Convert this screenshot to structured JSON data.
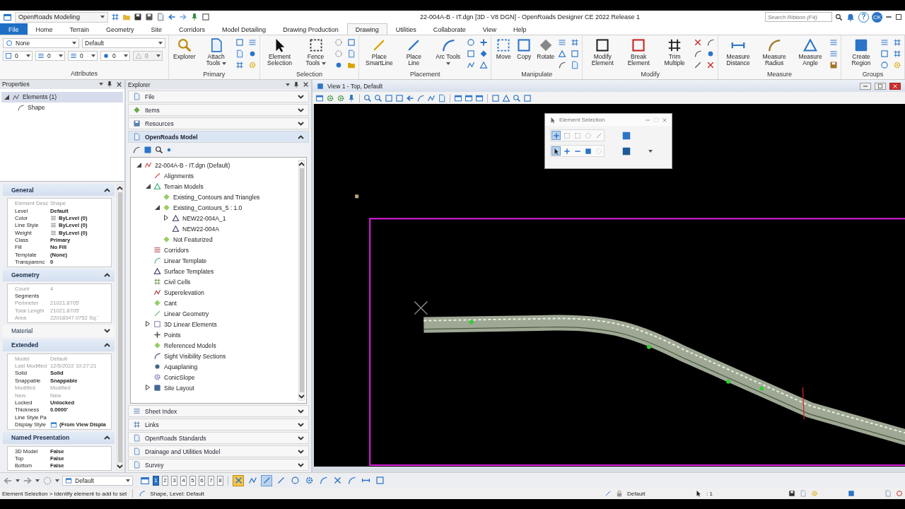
{
  "title_bar": {
    "workflow": "OpenRoads Modeling",
    "title": "22-004A-B - IT.dgn [3D - V8 DGN] - OpenRoads Designer CE 2022 Release 1",
    "search": {
      "placeholder": "Search Ribbon (F4)"
    },
    "help": "?",
    "user": "CK"
  },
  "ribbon_tabs": [
    {
      "label": "File",
      "kind": "backstage",
      "selected": false
    },
    {
      "label": "Home",
      "kind": "tab",
      "selected": false
    },
    {
      "label": "Terrain",
      "kind": "tab",
      "selected": false
    },
    {
      "label": "Geometry",
      "kind": "tab",
      "selected": false
    },
    {
      "label": "Site",
      "kind": "tab",
      "selected": false
    },
    {
      "label": "Corridors",
      "kind": "tab",
      "selected": false
    },
    {
      "label": "Model Detailing",
      "kind": "tab",
      "selected": false
    },
    {
      "label": "Drawing Production",
      "kind": "tab",
      "selected": false
    },
    {
      "label": "Drawing",
      "kind": "tab",
      "selected": true
    },
    {
      "label": "Utilities",
      "kind": "tab",
      "selected": false
    },
    {
      "label": "Collaborate",
      "kind": "tab",
      "selected": false
    },
    {
      "label": "View",
      "kind": "tab",
      "selected": false
    },
    {
      "label": "Help",
      "kind": "tab",
      "selected": false
    }
  ],
  "ribbon_groups": [
    {
      "label": "Attributes",
      "kind": "attributes",
      "dropdowns": [
        "None",
        "Default"
      ],
      "fields": [
        {
          "value": "0",
          "disabled": false
        },
        {
          "value": "0",
          "disabled": false
        },
        {
          "value": "0",
          "disabled": false
        },
        {
          "value": "0",
          "disabled": false
        },
        {
          "value": "0",
          "disabled": true
        }
      ]
    },
    {
      "label": "Primary",
      "kind": "tools",
      "buttons": [
        {
          "label": "Explorer",
          "dropdown": false
        },
        {
          "label": "Attach Tools",
          "dropdown": true
        }
      ]
    },
    {
      "label": "Selection",
      "kind": "tools",
      "buttons": [
        {
          "label": "Element Selection",
          "dropdown": false
        },
        {
          "label": "Fence Tools",
          "dropdown": true
        }
      ]
    },
    {
      "label": "Placement",
      "kind": "tools",
      "buttons": [
        {
          "label": "Place SmartLine",
          "dropdown": false
        },
        {
          "label": "Place Line",
          "dropdown": false
        },
        {
          "label": "Arc Tools",
          "dropdown": true
        }
      ]
    },
    {
      "label": "Manipulate",
      "kind": "tools",
      "buttons": [
        {
          "label": "Move",
          "dropdown": false
        },
        {
          "label": "Copy",
          "dropdown": false
        },
        {
          "label": "Rotate",
          "dropdown": false
        }
      ]
    },
    {
      "label": "Modify",
      "kind": "tools",
      "buttons": [
        {
          "label": "Modify Element",
          "dropdown": false
        },
        {
          "label": "Break Element",
          "dropdown": false
        },
        {
          "label": "Trim Multiple",
          "dropdown": false
        }
      ]
    },
    {
      "label": "Measure",
      "kind": "tools",
      "buttons": [
        {
          "label": "Measure Distance",
          "dropdown": false
        },
        {
          "label": "Measure Radius",
          "dropdown": false
        },
        {
          "label": "Measure Angle",
          "dropdown": false
        }
      ]
    },
    {
      "label": "Groups",
      "kind": "tools",
      "buttons": [
        {
          "label": "Create Region",
          "dropdown": false
        }
      ]
    }
  ],
  "properties": {
    "title": "Properties",
    "tree": [
      {
        "label": "Elements (1)",
        "selected": true,
        "children": [
          {
            "label": "Shape",
            "selected": false
          }
        ]
      }
    ],
    "sections": [
      {
        "title": "General",
        "expanded": true,
        "rows": [
          {
            "label": "Element Desc",
            "value": "Shape",
            "kind": "text",
            "readonly": true
          },
          {
            "label": "Level",
            "value": "Default",
            "kind": "text",
            "readonly": false
          },
          {
            "label": "Color",
            "value": "ByLevel (0)",
            "kind": "swatch",
            "readonly": false
          },
          {
            "label": "Line Style",
            "value": "ByLevel (0)",
            "kind": "swatch",
            "readonly": false
          },
          {
            "label": "Weight",
            "value": "ByLevel (0)",
            "kind": "swatch",
            "readonly": false
          },
          {
            "label": "Class",
            "value": "Primary",
            "kind": "text",
            "readonly": false
          },
          {
            "label": "Fill",
            "value": "No Fill",
            "kind": "text",
            "readonly": false
          },
          {
            "label": "Template",
            "value": "(None)",
            "kind": "text",
            "readonly": false
          },
          {
            "label": "Transparenc",
            "value": "0",
            "kind": "text",
            "readonly": false
          }
        ]
      },
      {
        "title": "Geometry",
        "expanded": true,
        "rows": [
          {
            "label": "Count",
            "value": "4",
            "kind": "text",
            "readonly": true
          },
          {
            "label": "Segments",
            "kind": "group",
            "readonly": false
          },
          {
            "label": "Perimeter",
            "value": "21021.8705'",
            "kind": "text",
            "readonly": true
          },
          {
            "label": "Total Length",
            "value": "21021.8705'",
            "kind": "text",
            "readonly": true
          },
          {
            "label": "Area",
            "value": "22018347.0752 Sq.'",
            "kind": "text",
            "readonly": true
          }
        ]
      },
      {
        "title": "Material",
        "expanded": false
      },
      {
        "title": "Extended",
        "expanded": true,
        "rows": [
          {
            "label": "Model",
            "value": "Default",
            "kind": "text",
            "readonly": true
          },
          {
            "label": "Last Modified",
            "value": "12/5/2022 10:27:21",
            "kind": "text",
            "readonly": true
          },
          {
            "label": "Solid",
            "value": "Solid",
            "kind": "text",
            "readonly": false
          },
          {
            "label": "Snappable",
            "value": "Snappable",
            "kind": "text",
            "readonly": false
          },
          {
            "label": "Modified",
            "value": "Modified",
            "kind": "text",
            "readonly": true
          },
          {
            "label": "New",
            "value": "New",
            "kind": "text",
            "readonly": true
          },
          {
            "label": "Locked",
            "value": "Unlocked",
            "kind": "text",
            "readonly": false
          },
          {
            "label": "Thickness",
            "value": "0.0000'",
            "kind": "text",
            "readonly": false
          },
          {
            "label": "Line Style Pa",
            "kind": "group",
            "readonly": false
          },
          {
            "label": "Display Style",
            "value": "(From View Displa",
            "kind": "style",
            "readonly": false
          }
        ]
      },
      {
        "title": "Named Presentation",
        "expanded": true,
        "rows": [
          {
            "label": "3D Model",
            "value": "False",
            "kind": "text",
            "readonly": false
          },
          {
            "label": "Top",
            "value": "False",
            "kind": "text",
            "readonly": false
          },
          {
            "label": "Bottom",
            "value": "False",
            "kind": "text",
            "readonly": false
          }
        ]
      }
    ]
  },
  "explorer": {
    "title": "Explorer",
    "sections": [
      {
        "title": "File",
        "expanded": false
      },
      {
        "title": "Items",
        "expanded": false
      },
      {
        "title": "Resources",
        "expanded": false
      },
      {
        "title": "OpenRoads Model",
        "expanded": true,
        "tree": [
          {
            "label": "22-004A-B - IT.dgn (Default)",
            "expanded": true,
            "children": [
              {
                "label": "Alignments"
              },
              {
                "label": "Terrain Models",
                "expanded": true,
                "children": [
                  {
                    "label": "Existing_Contours and Triangles"
                  },
                  {
                    "label": "Existing_Contours_5 : 1.0",
                    "expanded": true,
                    "children": [
                      {
                        "label": "NEW22-004A_1",
                        "expanded": false
                      },
                      {
                        "label": "NEW22-004A"
                      }
                    ]
                  },
                  {
                    "label": "Not Featurized"
                  }
                ]
              },
              {
                "label": "Corridors"
              },
              {
                "label": "Linear Template"
              },
              {
                "label": "Surface Templates"
              },
              {
                "label": "Civil Cells"
              },
              {
                "label": "Superelevation"
              },
              {
                "label": "Cant"
              },
              {
                "label": "Linear Geometry"
              },
              {
                "label": "3D Linear Elements",
                "expanded": false
              },
              {
                "label": "Points"
              },
              {
                "label": "Referenced Models"
              },
              {
                "label": "Sight Visibility Sections"
              },
              {
                "label": "Aquaplaning"
              },
              {
                "label": "ConicSlope"
              },
              {
                "label": "Site Layout",
                "expanded": false
              }
            ]
          }
        ]
      },
      {
        "title": "Sheet Index",
        "expanded": false
      },
      {
        "title": "Links",
        "expanded": false
      },
      {
        "title": "OpenRoads Standards",
        "expanded": false
      },
      {
        "title": "Drainage and Utilities Model",
        "expanded": false
      },
      {
        "title": "Survey",
        "expanded": false
      }
    ]
  },
  "view": {
    "title": "View 1 - Top, Default",
    "dialog": {
      "title": "Element Selection",
      "methods": [
        {
          "selected": true
        },
        {
          "selected": false
        },
        {
          "selected": false
        },
        {
          "selected": false
        },
        {
          "selected": false
        }
      ],
      "modes": [
        {
          "selected": true
        },
        {
          "selected": false
        },
        {
          "selected": false
        },
        {
          "selected": false
        },
        {
          "selected": false
        }
      ]
    }
  },
  "view_bar": {
    "dropdown": "Default",
    "views": [
      {
        "label": "1",
        "selected": true
      },
      {
        "label": "2",
        "selected": false
      },
      {
        "label": "3",
        "selected": false
      },
      {
        "label": "4",
        "selected": false
      },
      {
        "label": "5",
        "selected": false
      },
      {
        "label": "6",
        "selected": false
      },
      {
        "label": "7",
        "selected": false
      },
      {
        "label": "8",
        "selected": false
      }
    ],
    "snaps": [
      {
        "selected": true
      },
      {
        "selected": false
      },
      {
        "selected": true
      },
      {
        "selected": false
      },
      {
        "selected": false
      },
      {
        "selected": false
      },
      {
        "selected": false
      },
      {
        "selected": false
      },
      {
        "selected": false
      },
      {
        "selected": false
      },
      {
        "selected": false
      }
    ]
  },
  "status_bar": {
    "prompt": "Element Selection > Identify element to add to set",
    "message": "Shape, Level: Default",
    "active_level": "Default",
    "selection_count": ": 1"
  }
}
